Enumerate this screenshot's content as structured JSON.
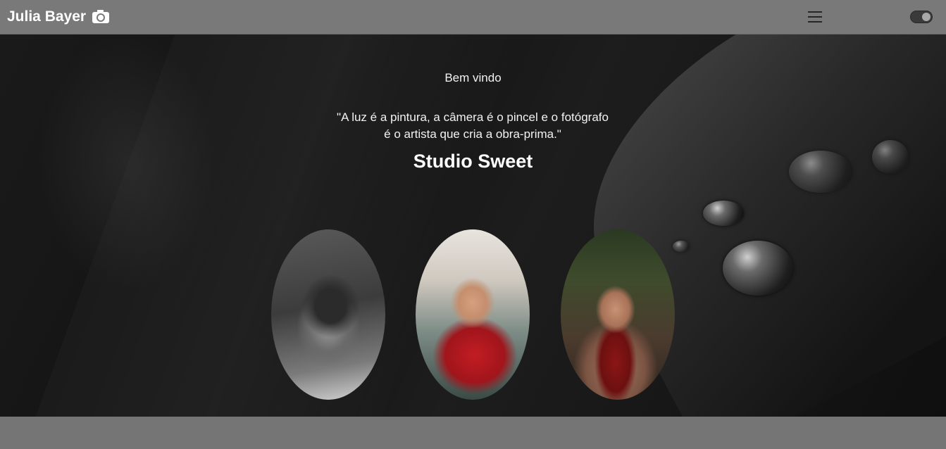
{
  "navbar": {
    "brand_name": "Julia Bayer",
    "brand_icon": "camera-icon",
    "menu_icon": "hamburger-menu-icon",
    "theme_toggle": {
      "icon": "toggle-switch-icon",
      "state": "on"
    }
  },
  "hero": {
    "welcome": "Bem vindo",
    "quote_line1": "\"A luz é a pintura, a câmera é o pincel e o fotógrafo",
    "quote_line2": "é o artista que cria a obra-prima.\"",
    "studio_name": "Studio Sweet"
  },
  "gallery": {
    "photos": [
      {
        "description": "black-and-white portrait of a boy"
      },
      {
        "description": "smiling toddler in red hoodie"
      },
      {
        "description": "boy with red scarf and leaf crown"
      }
    ]
  },
  "colors": {
    "navbar": "#7a797a",
    "hero_bg": "#141414",
    "text": "#ffffff"
  }
}
